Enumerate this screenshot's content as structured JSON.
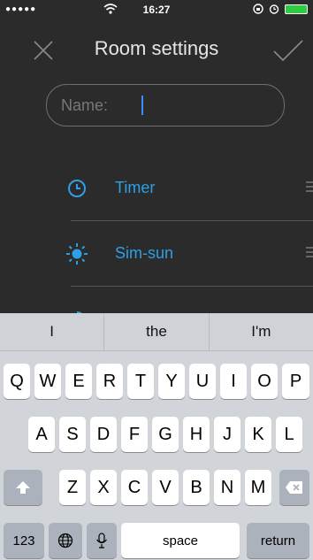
{
  "status_bar": {
    "signal": "●●●●●",
    "time": "16:27"
  },
  "nav": {
    "title": "Room settings"
  },
  "name_field": {
    "label": "Name:"
  },
  "rows": [
    {
      "label": "Timer",
      "icon": "clock-icon"
    },
    {
      "label": "Sim-sun",
      "icon": "sun-icon"
    }
  ],
  "suggestions": [
    "I",
    "the",
    "I'm"
  ],
  "keyboard": {
    "row1": [
      "Q",
      "W",
      "E",
      "R",
      "T",
      "Y",
      "U",
      "I",
      "O",
      "P"
    ],
    "row2": [
      "A",
      "S",
      "D",
      "F",
      "G",
      "H",
      "J",
      "K",
      "L"
    ],
    "row3": [
      "Z",
      "X",
      "C",
      "V",
      "B",
      "N",
      "M"
    ],
    "numbers_label": "123",
    "space_label": "space",
    "return_label": "return"
  },
  "colors": {
    "accent": "#2f9fe5",
    "background": "#2b2b2b",
    "keyboard": "#d1d4d9"
  }
}
